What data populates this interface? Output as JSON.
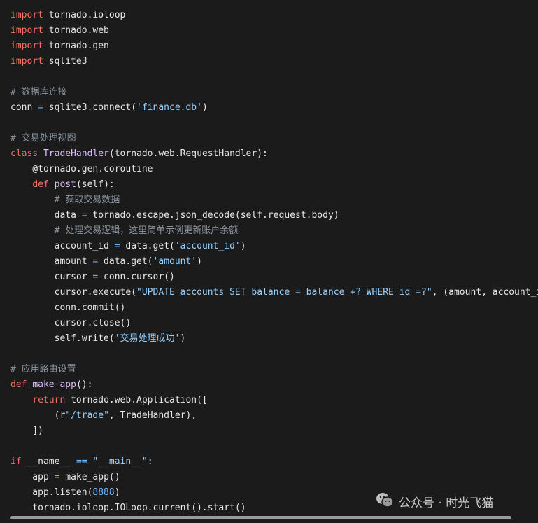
{
  "colors": {
    "background": "#1b1b1b",
    "keyword": "#f47067",
    "function": "#dcbdfb",
    "string": "#96d0ff",
    "comment": "#8b949e",
    "operator": "#6cb6ff",
    "number": "#6cb6ff",
    "text": "#e6e6e6"
  },
  "code_lines": [
    [
      [
        "kw",
        "import"
      ],
      [
        "tx",
        " tornado.ioloop"
      ]
    ],
    [
      [
        "kw",
        "import"
      ],
      [
        "tx",
        " tornado.web"
      ]
    ],
    [
      [
        "kw",
        "import"
      ],
      [
        "tx",
        " tornado.gen"
      ]
    ],
    [
      [
        "kw",
        "import"
      ],
      [
        "tx",
        " sqlite3"
      ]
    ],
    [],
    [
      [
        "cm",
        "# 数据库连接"
      ]
    ],
    [
      [
        "tx",
        "conn "
      ],
      [
        "op",
        "="
      ],
      [
        "tx",
        " sqlite3.connect("
      ],
      [
        "str",
        "'finance.db'"
      ],
      [
        "tx",
        ")"
      ]
    ],
    [],
    [
      [
        "cm",
        "# 交易处理视图"
      ]
    ],
    [
      [
        "kw",
        "class"
      ],
      [
        "tx",
        " "
      ],
      [
        "fn",
        "TradeHandler"
      ],
      [
        "tx",
        "(tornado.web.RequestHandler):"
      ]
    ],
    [
      [
        "tx",
        "    @tornado.gen.coroutine"
      ]
    ],
    [
      [
        "tx",
        "    "
      ],
      [
        "kw",
        "def"
      ],
      [
        "tx",
        " "
      ],
      [
        "fn",
        "post"
      ],
      [
        "tx",
        "(self):"
      ]
    ],
    [
      [
        "tx",
        "        "
      ],
      [
        "cm",
        "# 获取交易数据"
      ]
    ],
    [
      [
        "tx",
        "        data "
      ],
      [
        "op",
        "="
      ],
      [
        "tx",
        " tornado.escape.json_decode(self.request.body)"
      ]
    ],
    [
      [
        "tx",
        "        "
      ],
      [
        "cm",
        "# 处理交易逻辑，这里简单示例更新账户余额"
      ]
    ],
    [
      [
        "tx",
        "        account_id "
      ],
      [
        "op",
        "="
      ],
      [
        "tx",
        " data.get("
      ],
      [
        "str",
        "'account_id'"
      ],
      [
        "tx",
        ")"
      ]
    ],
    [
      [
        "tx",
        "        amount "
      ],
      [
        "op",
        "="
      ],
      [
        "tx",
        " data.get("
      ],
      [
        "str",
        "'amount'"
      ],
      [
        "tx",
        ")"
      ]
    ],
    [
      [
        "tx",
        "        cursor "
      ],
      [
        "op",
        "="
      ],
      [
        "tx",
        " conn.cursor()"
      ]
    ],
    [
      [
        "tx",
        "        cursor.execute("
      ],
      [
        "str",
        "\"UPDATE accounts SET balance = balance +? WHERE id =?\""
      ],
      [
        "tx",
        ", (amount, account_i"
      ]
    ],
    [
      [
        "tx",
        "        conn.commit()"
      ]
    ],
    [
      [
        "tx",
        "        cursor.close()"
      ]
    ],
    [
      [
        "tx",
        "        self.write("
      ],
      [
        "str",
        "'交易处理成功'"
      ],
      [
        "tx",
        ")"
      ]
    ],
    [],
    [
      [
        "cm",
        "# 应用路由设置"
      ]
    ],
    [
      [
        "kw",
        "def"
      ],
      [
        "tx",
        " "
      ],
      [
        "fn",
        "make_app"
      ],
      [
        "tx",
        "():"
      ]
    ],
    [
      [
        "tx",
        "    "
      ],
      [
        "kw",
        "return"
      ],
      [
        "tx",
        " tornado.web.Application(["
      ]
    ],
    [
      [
        "tx",
        "        (r"
      ],
      [
        "str",
        "\"/trade\""
      ],
      [
        "tx",
        ", TradeHandler),"
      ]
    ],
    [
      [
        "tx",
        "    ])"
      ]
    ],
    [],
    [
      [
        "kw",
        "if"
      ],
      [
        "tx",
        " __name__ "
      ],
      [
        "op",
        "=="
      ],
      [
        "tx",
        " "
      ],
      [
        "str",
        "\"__main__\""
      ],
      [
        "tx",
        ":"
      ]
    ],
    [
      [
        "tx",
        "    app "
      ],
      [
        "op",
        "="
      ],
      [
        "tx",
        " make_app()"
      ]
    ],
    [
      [
        "tx",
        "    app.listen("
      ],
      [
        "num",
        "8888"
      ],
      [
        "tx",
        ")"
      ]
    ],
    [
      [
        "tx",
        "    tornado.ioloop.IOLoop.current().start()"
      ]
    ]
  ],
  "watermark": {
    "icon": "wechat-icon",
    "text": "公众号 · 时光飞猫"
  }
}
